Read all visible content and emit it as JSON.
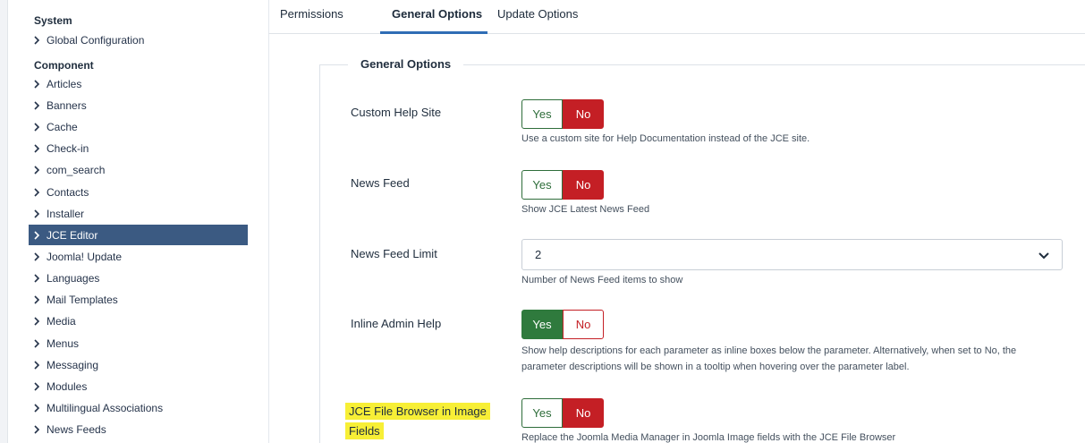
{
  "sidebar": {
    "system_heading": "System",
    "system_items": [
      {
        "label": "Global Configuration"
      }
    ],
    "component_heading": "Component",
    "component_items": [
      {
        "label": "Articles"
      },
      {
        "label": "Banners"
      },
      {
        "label": "Cache"
      },
      {
        "label": "Check-in"
      },
      {
        "label": "com_search"
      },
      {
        "label": "Contacts"
      },
      {
        "label": "Installer"
      },
      {
        "label": "JCE Editor",
        "active": true
      },
      {
        "label": "Joomla! Update"
      },
      {
        "label": "Languages"
      },
      {
        "label": "Mail Templates"
      },
      {
        "label": "Media"
      },
      {
        "label": "Menus"
      },
      {
        "label": "Messaging"
      },
      {
        "label": "Modules"
      },
      {
        "label": "Multilingual Associations"
      },
      {
        "label": "News Feeds"
      }
    ]
  },
  "tabs": [
    {
      "label": "Permissions"
    },
    {
      "label": "General Options",
      "active": true
    },
    {
      "label": "Update Options"
    }
  ],
  "fieldset": {
    "legend": "General Options"
  },
  "options": {
    "custom_help": {
      "label": "Custom Help Site",
      "yes": "Yes",
      "no": "No",
      "value": "No",
      "desc": "Use a custom site for Help Documentation instead of the JCE site."
    },
    "news_feed": {
      "label": "News Feed",
      "yes": "Yes",
      "no": "No",
      "value": "No",
      "desc": "Show JCE Latest News Feed"
    },
    "news_feed_limit": {
      "label": "News Feed Limit",
      "value": "2",
      "desc": "Number of News Feed items to show"
    },
    "inline_help": {
      "label": "Inline Admin Help",
      "yes": "Yes",
      "no": "No",
      "value": "Yes",
      "desc_line1": "Show help descriptions for each parameter as inline boxes below the parameter. Alternatively, when set to No, the",
      "desc_line2": "parameter descriptions will be shown in a tooltip when hovering over the parameter label."
    },
    "file_browser": {
      "label_line1": "JCE File Browser in Image",
      "label_line2": "Fields",
      "yes": "Yes",
      "no": "No",
      "value": "No",
      "desc": "Replace the Joomla Media Manager in Joomla Image fields with the JCE File Browser"
    }
  },
  "colors": {
    "active_sidebar": "#3b5a82",
    "yes_green": "#2f7a3d",
    "no_red": "#c41f25",
    "tab_accent": "#2f6db5",
    "highlight": "#f7ef36"
  }
}
